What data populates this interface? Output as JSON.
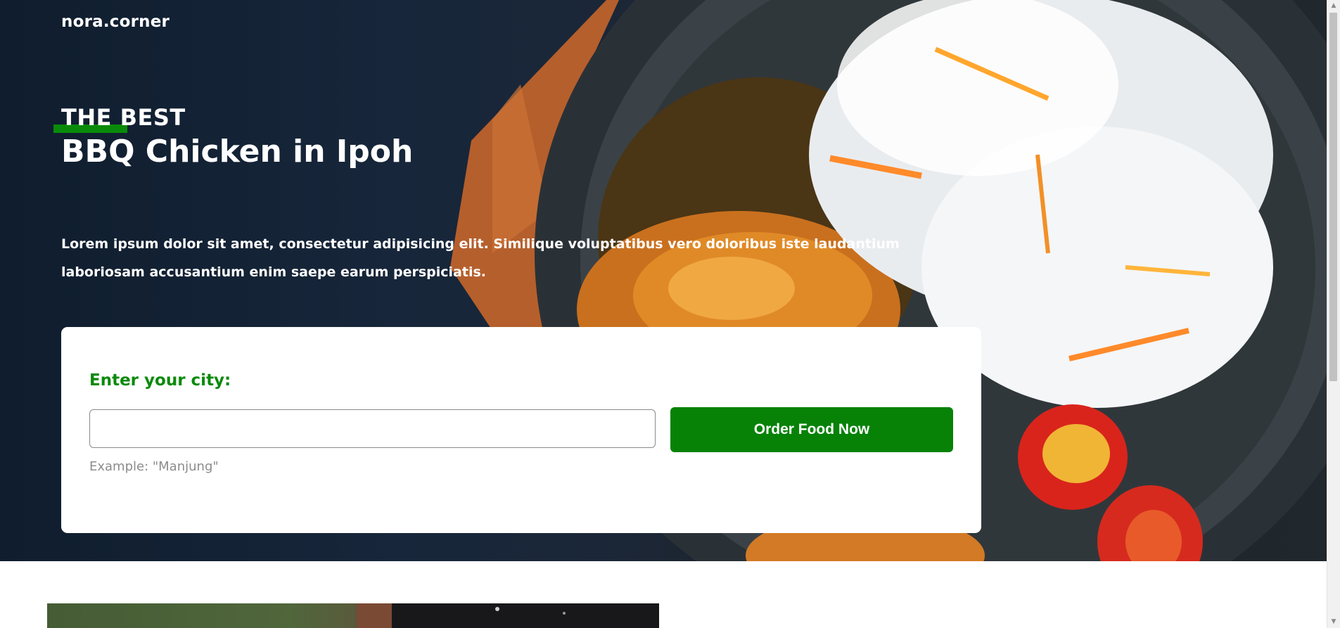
{
  "brand": {
    "name": "nora.corner"
  },
  "hero": {
    "eyebrow": "THE BEST",
    "title": "BBQ Chicken in Ipoh",
    "description": "Lorem ipsum dolor sit amet, consectetur adipisicing elit. Similique voluptatibus vero doloribus iste laudantium laboriosam accusantium enim saepe earum perspiciatis."
  },
  "order_form": {
    "label": "Enter your city:",
    "input_value": "",
    "hint": "Example: \"Manjung\"",
    "button_label": "Order Food Now"
  },
  "scrollbar": {
    "up_icon": "▲",
    "down_icon": "▼"
  },
  "colors": {
    "accent_green": "#0a8a0a",
    "button_green": "#078207",
    "hero_dark": "#17263a",
    "hint_gray": "#8c8c8c"
  }
}
